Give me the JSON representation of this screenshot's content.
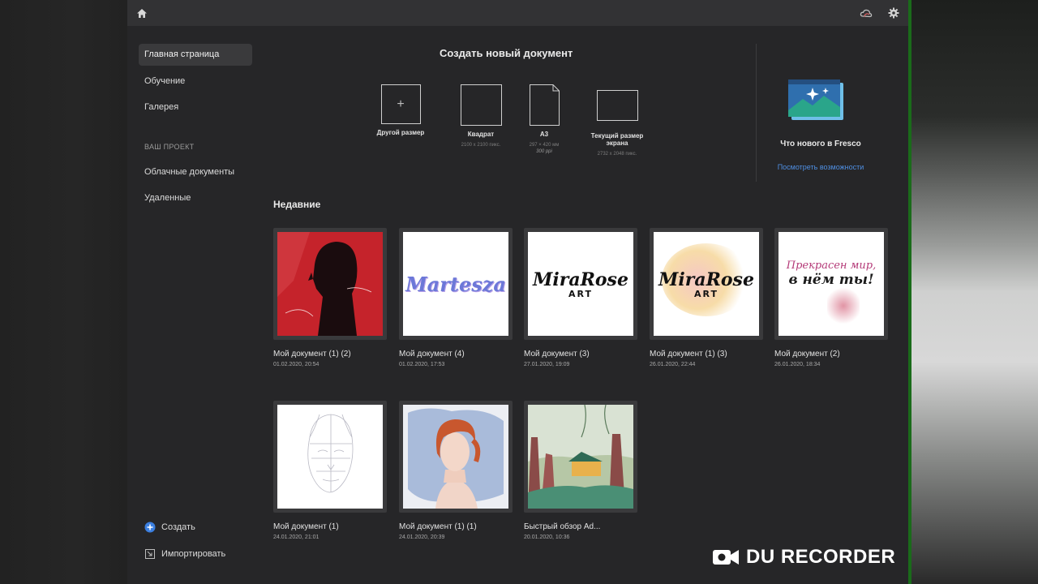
{
  "colors": {
    "accent": "#4f8fe3",
    "background": "#262628",
    "topbar": "#323234"
  },
  "topbar": {
    "icons": [
      "home-icon",
      "cloud-sync-icon",
      "gear-icon"
    ]
  },
  "sidebar": {
    "items": [
      {
        "label": "Главная страница",
        "active": true
      },
      {
        "label": "Обучение"
      },
      {
        "label": "Галерея"
      }
    ],
    "section_label": "ВАШ ПРОЕКТ",
    "project_items": [
      {
        "label": "Облачные документы"
      },
      {
        "label": "Удаленные"
      }
    ],
    "create_label": "Создать",
    "import_label": "Импортировать"
  },
  "new_doc": {
    "title": "Создать новый документ",
    "presets": [
      {
        "label": "Другой размер",
        "sub": "",
        "sub2": ""
      },
      {
        "label": "Квадрат",
        "sub": "2100 x 2100 пикс.",
        "sub2": ""
      },
      {
        "label": "A3",
        "sub": "297 × 420 мм",
        "sub2": "300 ppi"
      },
      {
        "label": "Текущий размер экрана",
        "sub": "2732 x 2048 пикс.",
        "sub2": ""
      }
    ]
  },
  "whats_new": {
    "title": "Что нового в Fresco",
    "link": "Посмотреть возможности"
  },
  "recent": {
    "title": "Недавние",
    "items": [
      {
        "name": "Мой документ (1) (2)",
        "date": "01.02.2020, 20:54",
        "thumb": "red-portrait"
      },
      {
        "name": "Мой документ (4)",
        "date": "01.02.2020, 17:53",
        "thumb": "lettering-blue",
        "thumb_text": "Martesza"
      },
      {
        "name": "Мой документ (3)",
        "date": "27.01.2020, 19:09",
        "thumb": "lettering-black",
        "thumb_text": "MiraRose",
        "thumb_text2": "ART"
      },
      {
        "name": "Мой документ (1) (3)",
        "date": "26.01.2020, 22:44",
        "thumb": "lettering-watercolor",
        "thumb_text": "MiraRose",
        "thumb_text2": "ART"
      },
      {
        "name": "Мой документ (2)",
        "date": "26.01.2020, 18:34",
        "thumb": "lettering-pink",
        "thumb_text": "Прекрасен мир,",
        "thumb_text2": "в нём ты!"
      },
      {
        "name": "Мой документ (1)",
        "date": "24.01.2020, 21:01",
        "thumb": "face-sketch"
      },
      {
        "name": "Мой документ (1) (1)",
        "date": "24.01.2020, 20:39",
        "thumb": "woman-portrait"
      },
      {
        "name": "Быстрый обзор Ad...",
        "date": "20.01.2020, 10:36",
        "thumb": "landscape"
      }
    ]
  },
  "watermark": {
    "text": "DU RECORDER"
  }
}
